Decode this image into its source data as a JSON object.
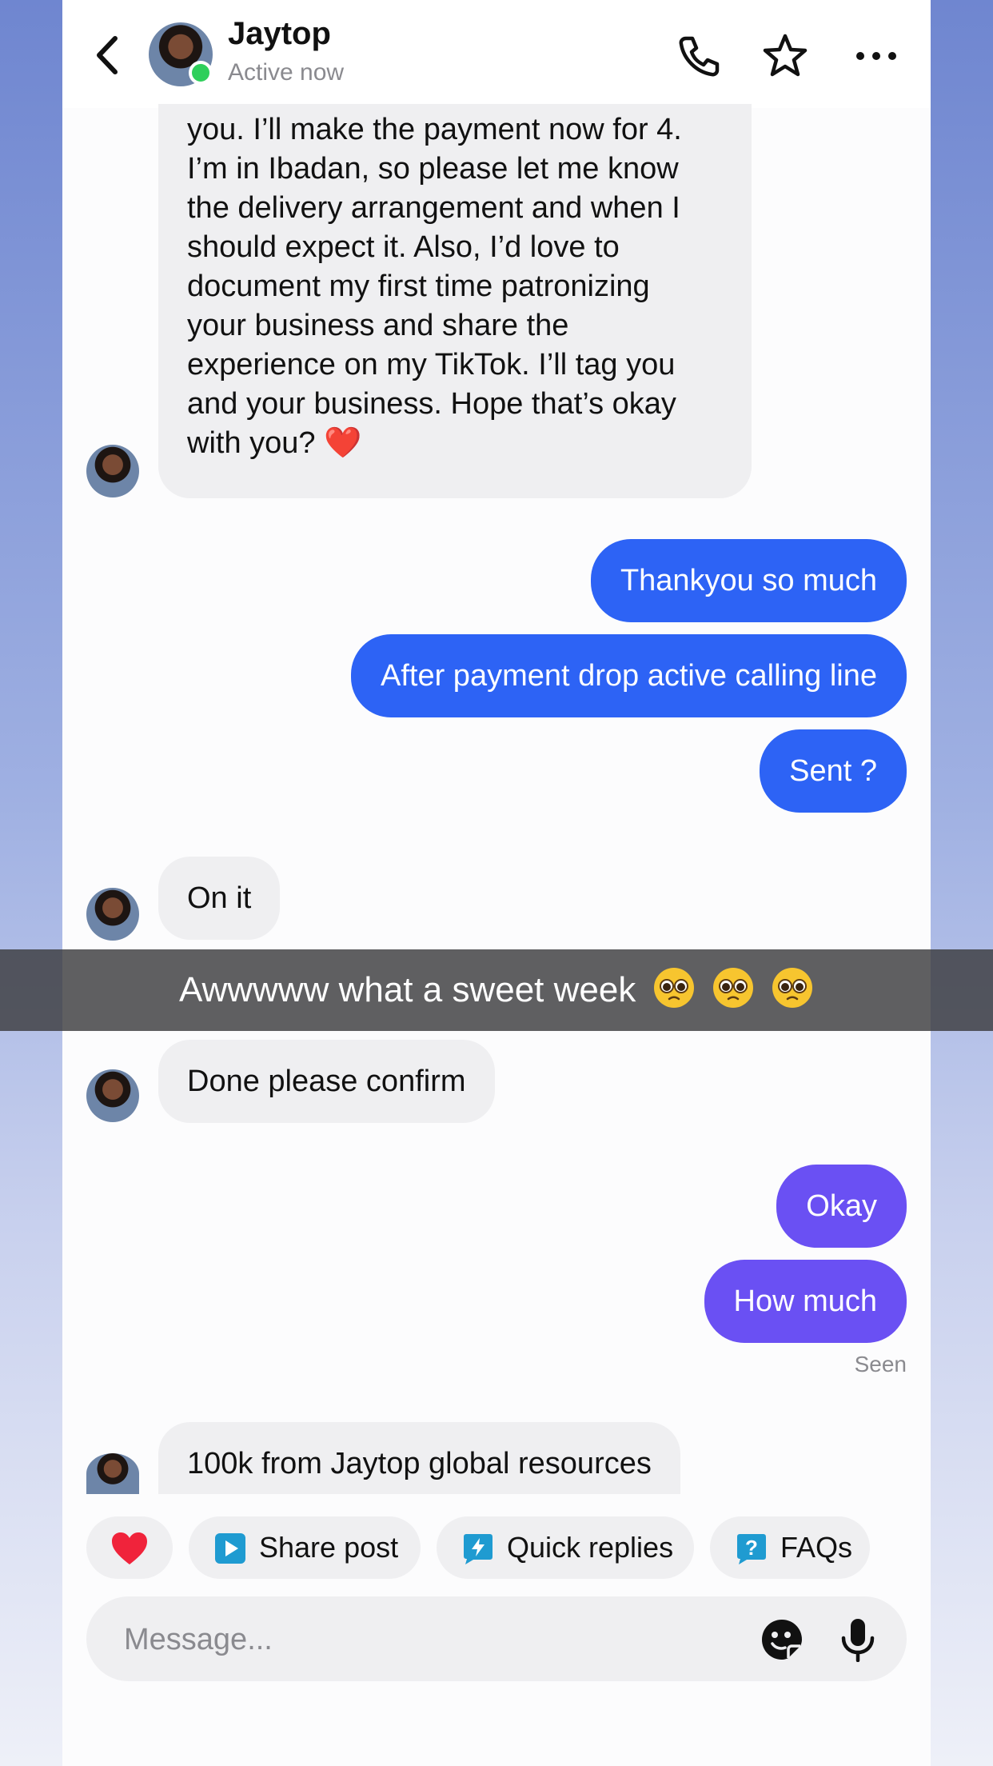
{
  "header": {
    "name": "Jaytop",
    "status": "Active now",
    "icons": [
      "back-chevron-icon",
      "phone-icon",
      "star-icon",
      "more-dots-icon"
    ]
  },
  "messages": [
    {
      "from": "them",
      "text": "you. I’ll make the payment now for 4.\nI’m in Ibadan, so please let me know\nthe delivery arrangement and when I\nshould expect it. Also, I’d love to\ndocument my first time patronizing\nyour business and share the\nexperience on my TikTok. I’ll tag you\nand your business. Hope that’s okay\nwith you? ❤️"
    },
    {
      "from": "me",
      "text": "Thankyou so much"
    },
    {
      "from": "me",
      "text": "After payment drop active calling line"
    },
    {
      "from": "me",
      "text": "Sent ?"
    },
    {
      "from": "them",
      "text": "On it"
    },
    {
      "from": "them",
      "text": "Done please confirm"
    },
    {
      "from": "me",
      "text": "Okay"
    },
    {
      "from": "me",
      "text": "How much"
    },
    {
      "from": "them",
      "text": "100k from Jaytop global resources"
    }
  ],
  "seen_label": "Seen",
  "overlay_caption": "Awwwww what a sweet week",
  "quick_actions": {
    "share_post": "Share post",
    "quick_replies": "Quick replies",
    "faqs": "FAQs"
  },
  "composer": {
    "placeholder": "Message..."
  },
  "colors": {
    "outgoing_blue": "#2d63f5",
    "outgoing_purple": "#6a50f3",
    "incoming_gray": "#efeff1",
    "online_green": "#2fcf5b",
    "heart_red": "#f0233b",
    "share_icon_blue": "#1f9bd1"
  }
}
